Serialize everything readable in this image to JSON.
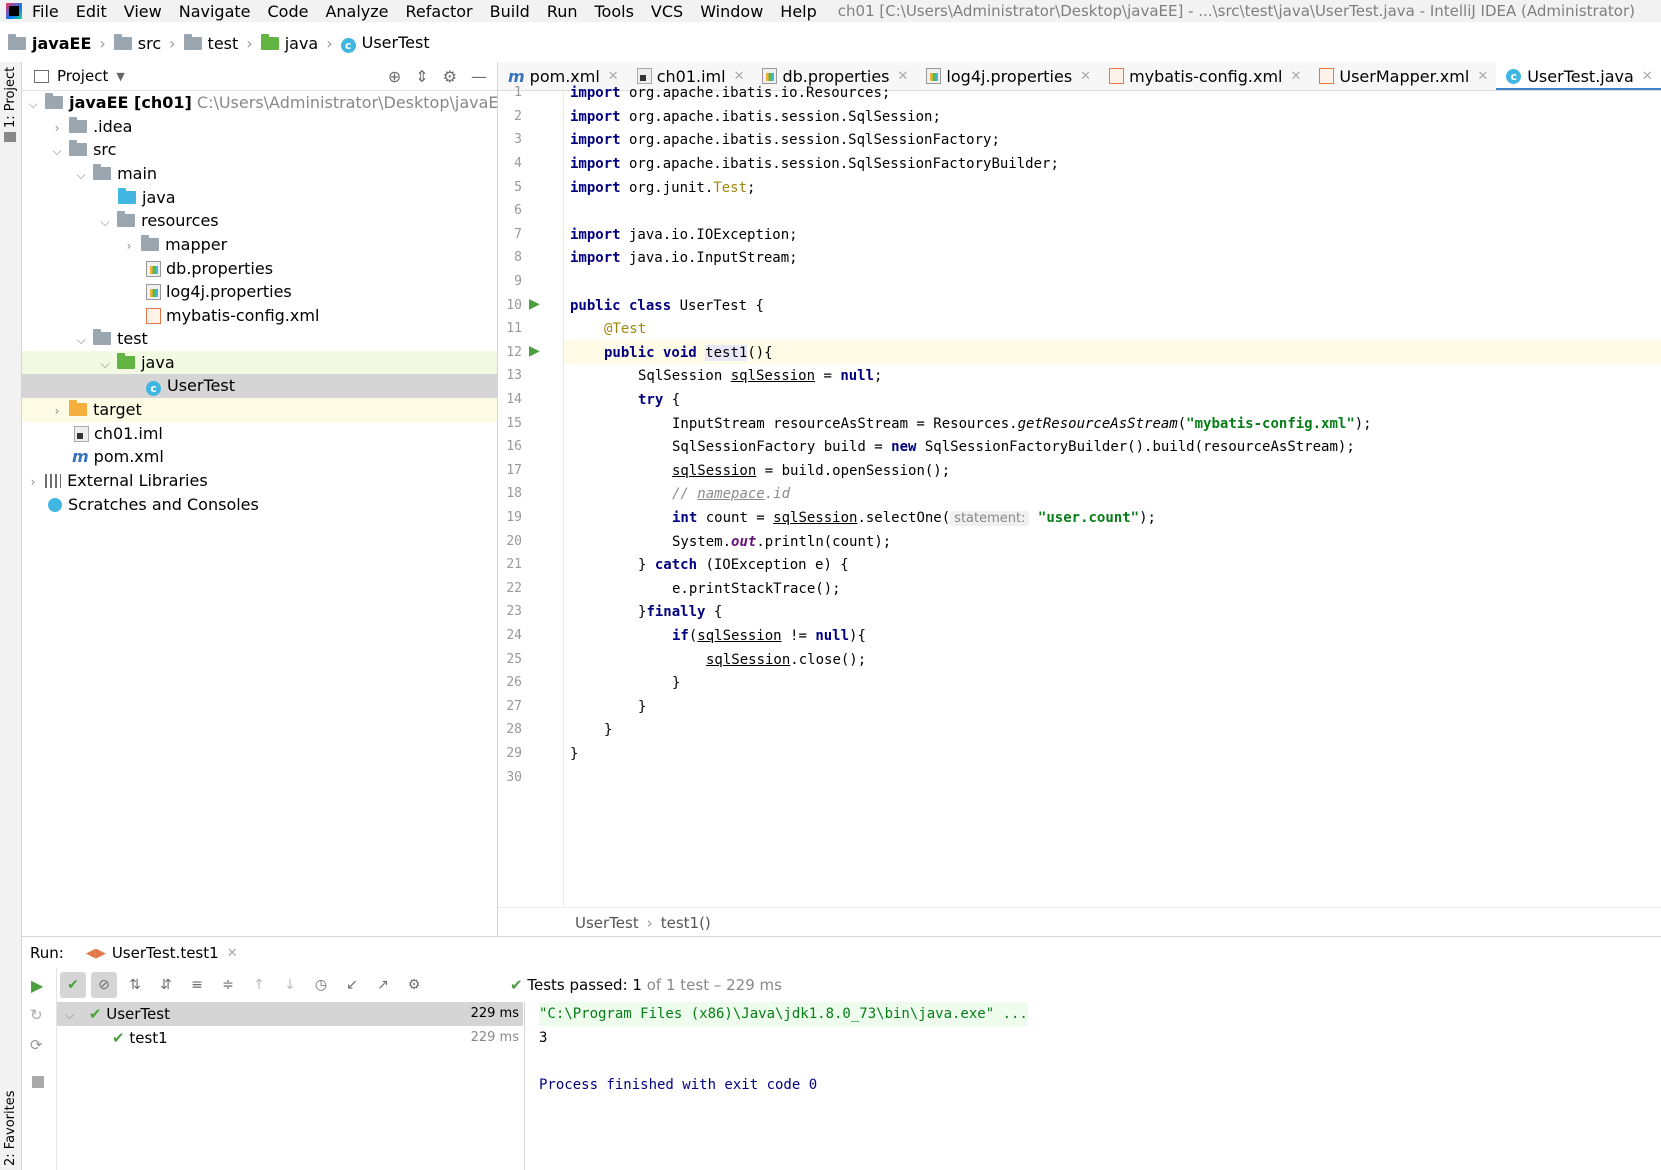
{
  "menu": [
    "File",
    "Edit",
    "View",
    "Navigate",
    "Code",
    "Analyze",
    "Refactor",
    "Build",
    "Run",
    "Tools",
    "VCS",
    "Window",
    "Help"
  ],
  "window_title": "ch01 [C:\\Users\\Administrator\\Desktop\\javaEE] - ...\\src\\test\\java\\UserTest.java - IntelliJ IDEA (Administrator)",
  "breadcrumb": [
    "javaEE",
    "src",
    "test",
    "java",
    "UserTest"
  ],
  "left_strip": {
    "project": "1: Project",
    "favorites": "2: Favorites"
  },
  "project_panel": {
    "title": "Project"
  },
  "tree": [
    {
      "label": "javaEE [ch01]",
      "extra": "C:\\Users\\Administrator\\Desktop\\javaEE",
      "icon": "module-folder-icon"
    },
    {
      "label": ".idea",
      "icon": "folder-icon"
    },
    {
      "label": "src",
      "icon": "folder-icon"
    },
    {
      "label": "main",
      "icon": "folder-icon"
    },
    {
      "label": "java",
      "icon": "source-folder-icon"
    },
    {
      "label": "resources",
      "icon": "resources-folder-icon"
    },
    {
      "label": "mapper",
      "icon": "folder-icon"
    },
    {
      "label": "db.properties",
      "icon": "properties-file-icon"
    },
    {
      "label": "log4j.properties",
      "icon": "properties-file-icon"
    },
    {
      "label": "mybatis-config.xml",
      "icon": "xml-file-icon"
    },
    {
      "label": "test",
      "icon": "folder-icon"
    },
    {
      "label": "java",
      "icon": "test-folder-icon"
    },
    {
      "label": "UserTest",
      "icon": "class-icon"
    },
    {
      "label": "target",
      "icon": "excluded-folder-icon"
    },
    {
      "label": "ch01.iml",
      "icon": "iml-file-icon"
    },
    {
      "label": "pom.xml",
      "icon": "maven-icon"
    },
    {
      "label": "External Libraries",
      "icon": "libraries-icon"
    },
    {
      "label": "Scratches and Consoles",
      "icon": "scratches-icon"
    }
  ],
  "tabs": [
    {
      "label": "pom.xml",
      "icon": "maven-icon"
    },
    {
      "label": "ch01.iml",
      "icon": "iml-file-icon"
    },
    {
      "label": "db.properties",
      "icon": "properties-file-icon"
    },
    {
      "label": "log4j.properties",
      "icon": "properties-file-icon"
    },
    {
      "label": "mybatis-config.xml",
      "icon": "xml-file-icon"
    },
    {
      "label": "UserMapper.xml",
      "icon": "xml-file-icon"
    },
    {
      "label": "UserTest.java",
      "icon": "class-icon"
    }
  ],
  "line_numbers": [
    "1",
    "2",
    "3",
    "4",
    "5",
    "6",
    "7",
    "8",
    "9",
    "10",
    "11",
    "12",
    "13",
    "14",
    "15",
    "16",
    "17",
    "18",
    "19",
    "20",
    "21",
    "22",
    "23",
    "24",
    "25",
    "26",
    "27",
    "28",
    "29",
    "30"
  ],
  "code": {
    "l1_kw": "import",
    "l1": " org.apache.ibatis.io.Resources;",
    "l2_kw": "import",
    "l2": " org.apache.ibatis.session.SqlSession;",
    "l3_kw": "import",
    "l3": " org.apache.ibatis.session.SqlSessionFactory;",
    "l4_kw": "import",
    "l4": " org.apache.ibatis.session.SqlSessionFactoryBuilder;",
    "l5_kw": "import",
    "l5_a": " org.junit.",
    "l5_b": "Test",
    "l5_c": ";",
    "l7_kw": "import",
    "l7": " java.io.IOException;",
    "l8_kw": "import",
    "l8": " java.io.InputStream;",
    "l10_kw": "public class",
    "l10": " UserTest {",
    "l11": "@Test",
    "l12_kw": "public void",
    "l12_a": " ",
    "l12_b": "test1",
    "l12_c": "(){",
    "l13_a": "SqlSession ",
    "l13_b": "sqlSession",
    "l13_c": " = ",
    "l13_kw": "null",
    "l13_d": ";",
    "l14_kw": "try",
    "l14": " {",
    "l15_a": "InputStream resourceAsStream = Resources.",
    "l15_b": "getResourceAsStream",
    "l15_c": "(",
    "l15_str": "\"mybatis-config.xml\"",
    "l15_d": ");",
    "l16_a": "SqlSessionFactory build = ",
    "l16_kw": "new",
    "l16_b": " SqlSessionFactoryBuilder().build(resourceAsStream);",
    "l17_a": "sqlSession",
    "l17_b": " = build.openSession();",
    "l18_a": "// ",
    "l18_b": "namepace",
    "l18_c": ".id",
    "l19_kw": "int",
    "l19_a": " count = ",
    "l19_b": "sqlSession",
    "l19_c": ".selectOne(",
    "l19_hint": "statement:",
    "l19_str": "\"user.count\"",
    "l19_d": ");",
    "l20_a": "System.",
    "l20_b": "out",
    "l20_c": ".println(count);",
    "l21_a": "} ",
    "l21_kw": "catch",
    "l21_b": " (IOException e) {",
    "l22": "e.printStackTrace();",
    "l23_a": "}",
    "l23_kw": "finally",
    "l23_b": " {",
    "l24_kw": "if",
    "l24_a": "(",
    "l24_b": "sqlSession",
    "l24_c": " != ",
    "l24_kw2": "null",
    "l24_d": "){",
    "l25_a": "sqlSession",
    "l25_b": ".close();",
    "l26": "}",
    "l27": "}",
    "l28": "}",
    "l29": "}"
  },
  "editor_crumbs": [
    "UserTest",
    "test1()"
  ],
  "run": {
    "label": "Run:",
    "tab": "UserTest.test1",
    "status_a": "Tests passed:",
    "status_b": "1",
    "status_c": "of 1 test – 229 ms",
    "tree": [
      {
        "label": "UserTest",
        "time": "229 ms"
      },
      {
        "label": "test1",
        "time": "229 ms"
      }
    ],
    "console": [
      "\"C:\\Program Files (x86)\\Java\\jdk1.8.0_73\\bin\\java.exe\" ...",
      "3",
      "",
      "Process finished with exit code 0"
    ]
  },
  "colors": {
    "keyword": "#000080",
    "string": "#067d17",
    "annotation": "#9e880d",
    "pass": "#4c9e3f",
    "accent": "#4083c9"
  }
}
